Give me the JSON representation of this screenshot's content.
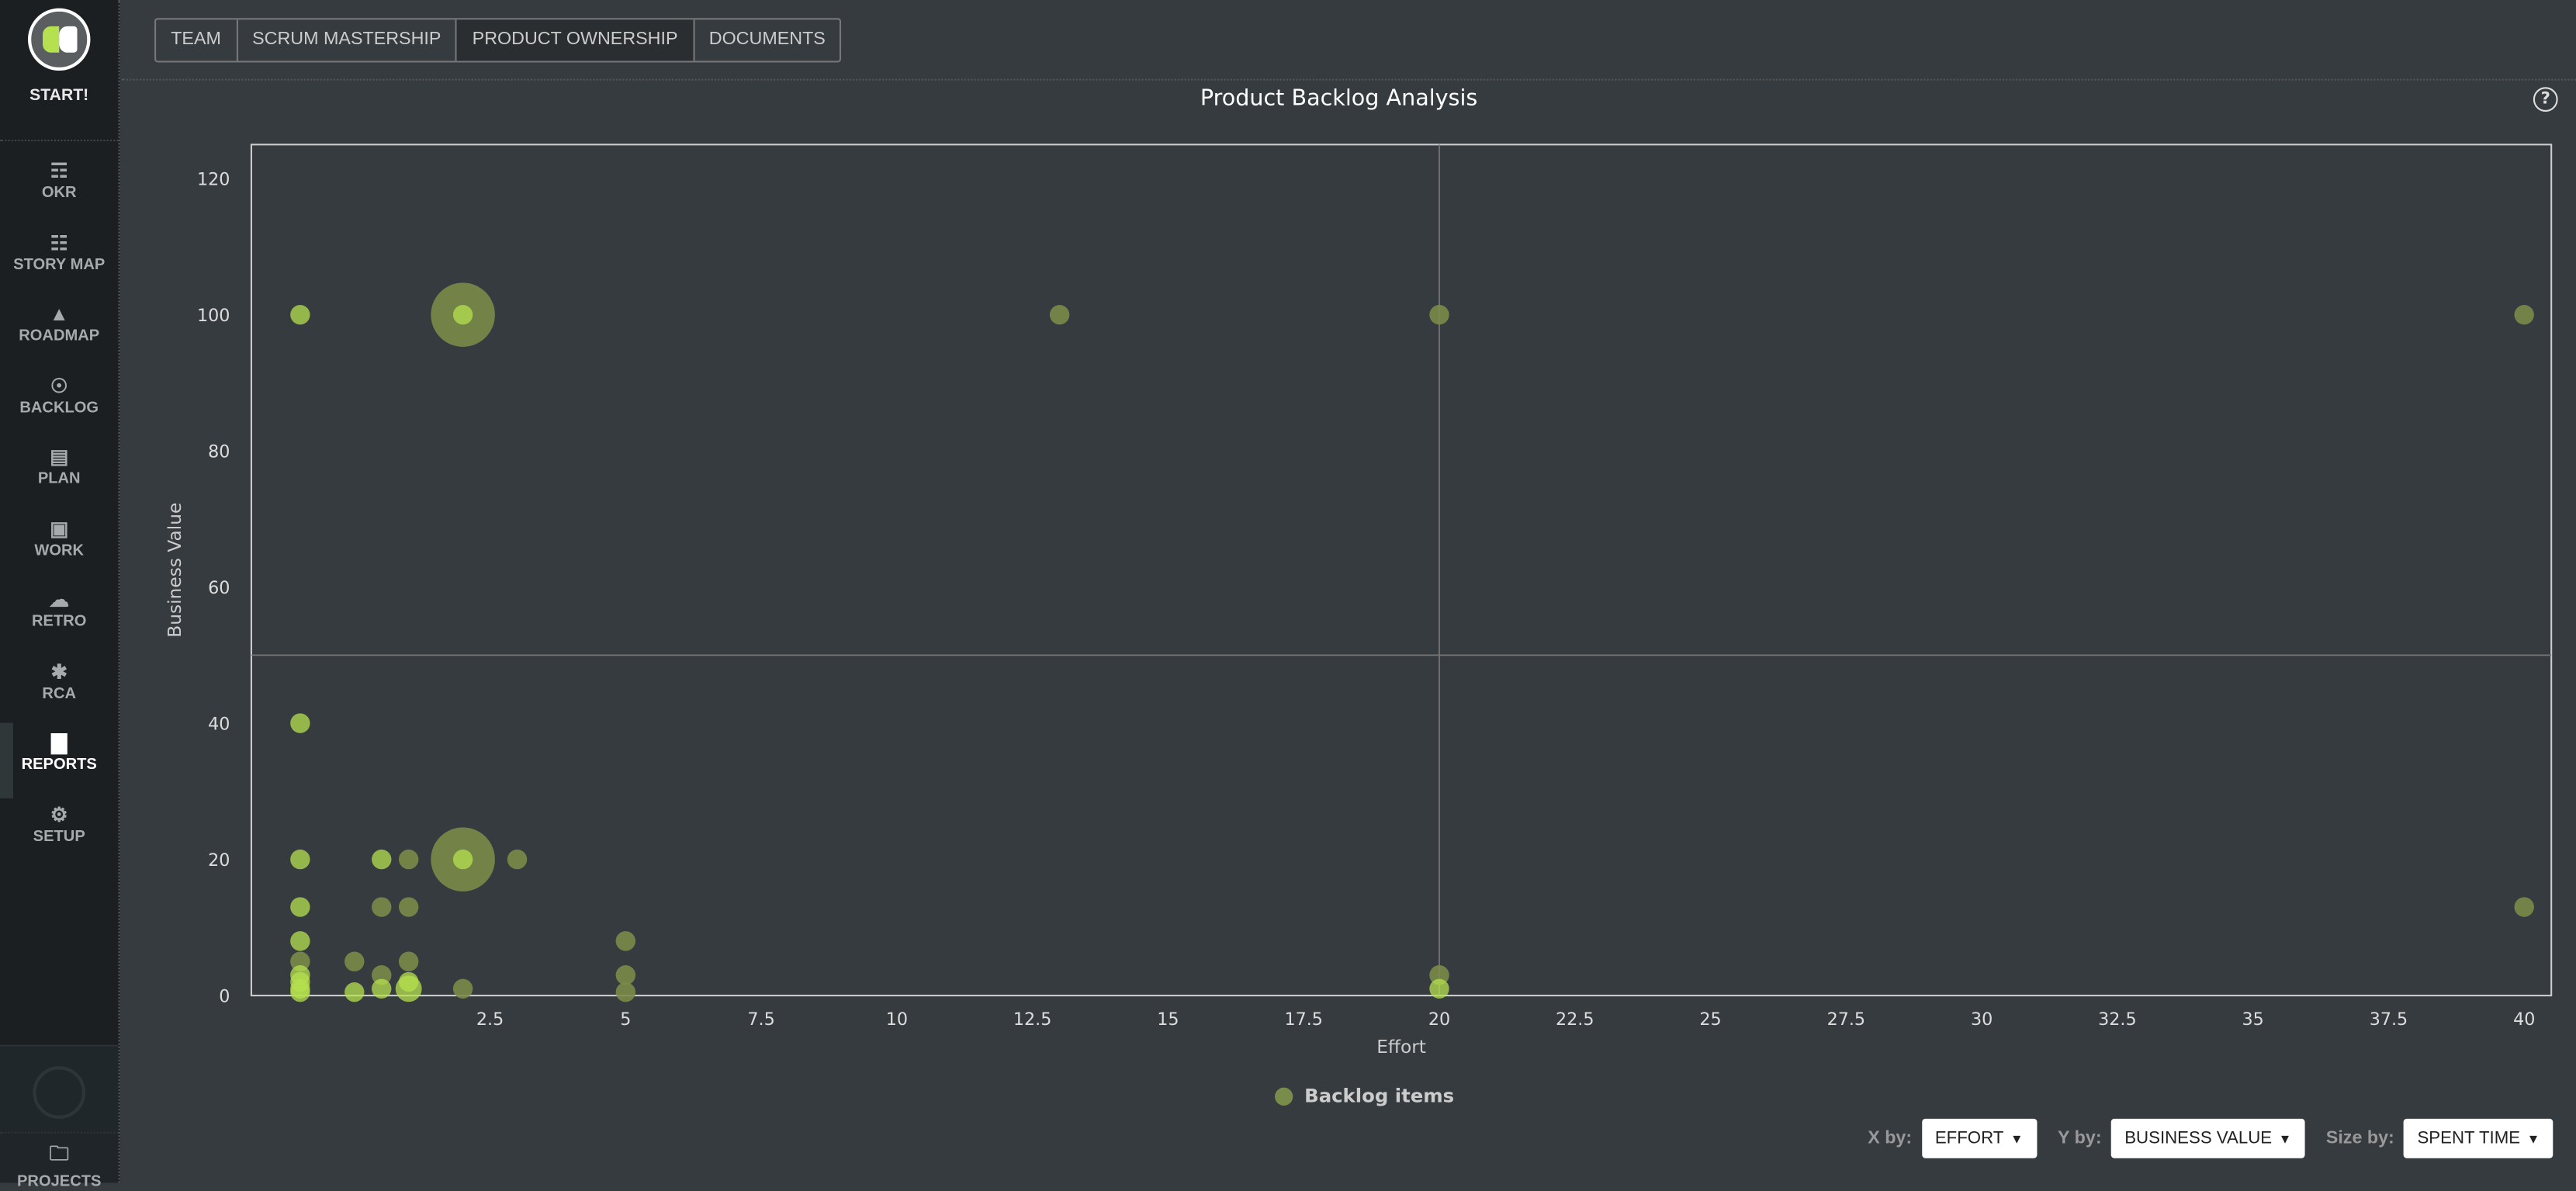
{
  "sidebar": {
    "start_label": "START!",
    "items": [
      {
        "label": "OKR",
        "icon": "okr-icon",
        "glyph": "☶"
      },
      {
        "label": "STORY MAP",
        "icon": "grid-icon",
        "glyph": "☷"
      },
      {
        "label": "ROADMAP",
        "icon": "road-icon",
        "glyph": "▲"
      },
      {
        "label": "BACKLOG",
        "icon": "lightbulb-icon",
        "glyph": "☉"
      },
      {
        "label": "PLAN",
        "icon": "plan-icon",
        "glyph": "▤"
      },
      {
        "label": "WORK",
        "icon": "briefcase-icon",
        "glyph": "▣"
      },
      {
        "label": "RETRO",
        "icon": "chat-icon",
        "glyph": "☁"
      },
      {
        "label": "RCA",
        "icon": "share-icon",
        "glyph": "✱"
      },
      {
        "label": "REPORTS",
        "icon": "bar-chart-icon",
        "glyph": "▇",
        "active": true
      },
      {
        "label": "SETUP",
        "icon": "gear-icon",
        "glyph": "⚙"
      }
    ],
    "projects_label": "PROJECTS"
  },
  "tabs": [
    {
      "label": "TEAM"
    },
    {
      "label": "SCRUM MASTERSHIP"
    },
    {
      "label": "PRODUCT OWNERSHIP",
      "active": true
    },
    {
      "label": "DOCUMENTS"
    }
  ],
  "help_glyph": "?",
  "legend_label": "Backlog items",
  "controls": {
    "x_label": "X by:",
    "x_value": "EFFORT",
    "y_label": "Y by:",
    "y_value": "BUSINESS VALUE",
    "size_label": "Size by:",
    "size_value": "SPENT TIME",
    "caret": "▼"
  },
  "colors": {
    "point": "#7a8c49",
    "point_light": "#b5e04f",
    "background": "#363b3f"
  },
  "chart_data": {
    "type": "scatter",
    "title": "Product Backlog Analysis",
    "xlabel": "Effort",
    "ylabel": "Business Value",
    "xlim": [
      -1.9,
      40.5
    ],
    "ylim": [
      0,
      125
    ],
    "xticks": [
      2.5,
      5,
      7.5,
      10,
      12.5,
      15,
      17.5,
      20,
      22.5,
      25,
      27.5,
      30,
      32.5,
      35,
      37.5,
      40
    ],
    "xtick_labels": [
      "2.5",
      "5",
      "7.5",
      "10",
      "12.5",
      "15",
      "17.5",
      "20",
      "22.5",
      "25",
      "27.5",
      "30",
      "32.5",
      "35",
      "37.5",
      "40"
    ],
    "yticks": [
      0,
      20,
      40,
      60,
      80,
      100,
      120
    ],
    "quadrant_lines": {
      "x": 20,
      "y": 50
    },
    "legend": "bottom-center",
    "series": [
      {
        "name": "Backlog items",
        "points": [
          {
            "x": -1,
            "y": 100,
            "size": 1,
            "light": true
          },
          {
            "x": 2,
            "y": 100,
            "size": 10
          },
          {
            "x": 2,
            "y": 100,
            "size": 1,
            "light": true
          },
          {
            "x": 13,
            "y": 100,
            "size": 1
          },
          {
            "x": 20,
            "y": 100,
            "size": 1
          },
          {
            "x": 40,
            "y": 100,
            "size": 1
          },
          {
            "x": -1,
            "y": 40,
            "size": 1,
            "light": true
          },
          {
            "x": -1,
            "y": 20,
            "size": 1,
            "light": true
          },
          {
            "x": 0.5,
            "y": 20,
            "size": 1,
            "light": true
          },
          {
            "x": 1,
            "y": 20,
            "size": 1
          },
          {
            "x": 2,
            "y": 20,
            "size": 10
          },
          {
            "x": 2,
            "y": 20,
            "size": 1,
            "light": true
          },
          {
            "x": 3,
            "y": 20,
            "size": 1
          },
          {
            "x": -1,
            "y": 13,
            "size": 1,
            "light": true
          },
          {
            "x": 0.5,
            "y": 13,
            "size": 1
          },
          {
            "x": 1,
            "y": 13,
            "size": 1
          },
          {
            "x": 40,
            "y": 13,
            "size": 1
          },
          {
            "x": -1,
            "y": 8,
            "size": 1,
            "light": true
          },
          {
            "x": 5,
            "y": 8,
            "size": 1
          },
          {
            "x": -1,
            "y": 5,
            "size": 1
          },
          {
            "x": 0,
            "y": 5,
            "size": 1
          },
          {
            "x": 1,
            "y": 5,
            "size": 1
          },
          {
            "x": -1,
            "y": 3,
            "size": 1,
            "light": true
          },
          {
            "x": -1,
            "y": 2,
            "size": 1,
            "light": true
          },
          {
            "x": 0.5,
            "y": 3,
            "size": 1
          },
          {
            "x": 1,
            "y": 2,
            "size": 1,
            "light": true
          },
          {
            "x": 5,
            "y": 3,
            "size": 1
          },
          {
            "x": 20,
            "y": 3,
            "size": 1
          },
          {
            "x": -1,
            "y": 1,
            "size": 1,
            "light": true
          },
          {
            "x": -1,
            "y": 0.5,
            "size": 1,
            "light": true
          },
          {
            "x": 0,
            "y": 0.5,
            "size": 1,
            "light": true
          },
          {
            "x": 0.5,
            "y": 1,
            "size": 1,
            "light": true
          },
          {
            "x": 1,
            "y": 1,
            "size": 2,
            "light": true
          },
          {
            "x": 2,
            "y": 1,
            "size": 1
          },
          {
            "x": 5,
            "y": 0.5,
            "size": 1
          },
          {
            "x": 20,
            "y": 1,
            "size": 1,
            "light": true
          }
        ]
      }
    ]
  }
}
